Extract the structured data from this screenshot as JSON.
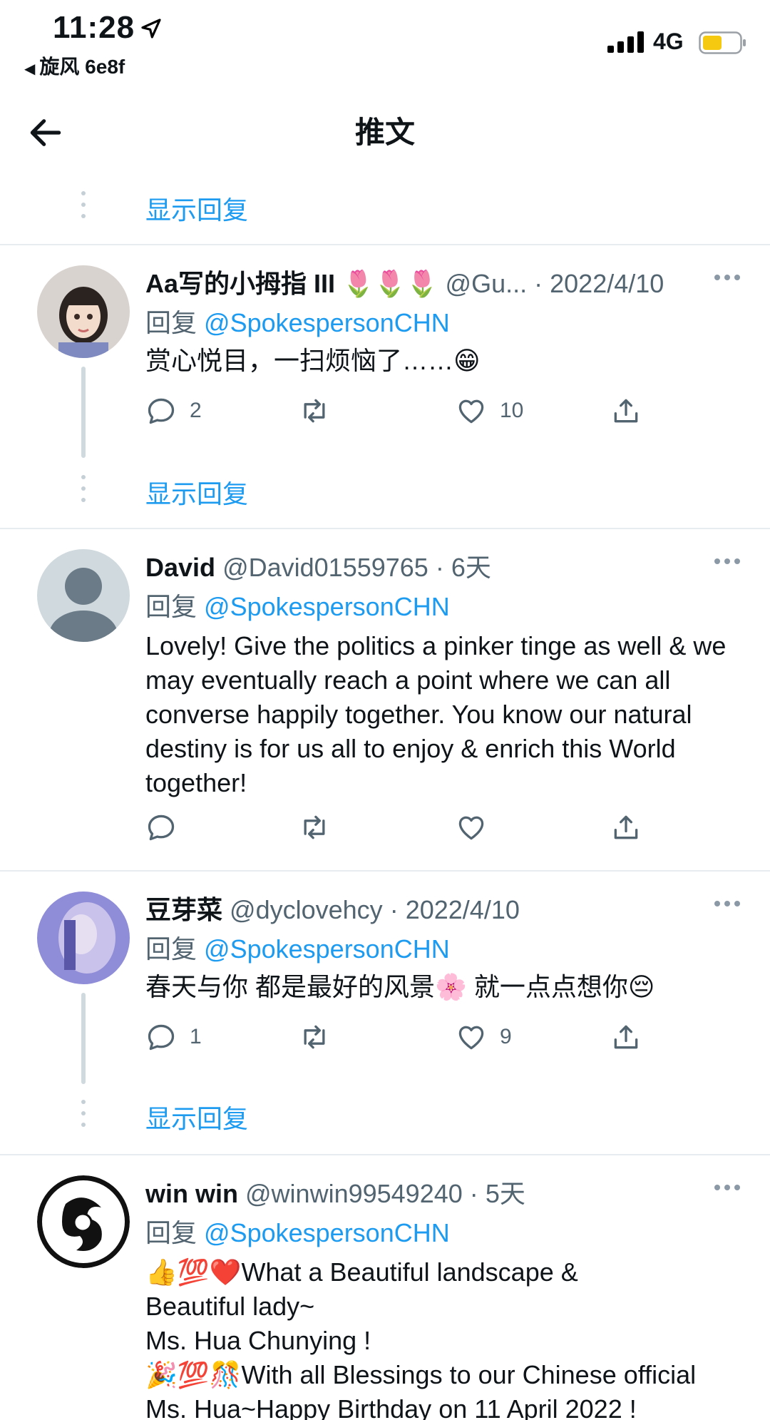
{
  "status": {
    "time": "11:28",
    "back_app": "旋风 6e8f",
    "network": "4G"
  },
  "nav": {
    "title": "推文"
  },
  "show_replies_label": "显示回复",
  "tweets": [
    {
      "name": "Aa写的小拇指 III 🌷🌷🌷",
      "handle": "@Gu...",
      "sep": "·",
      "date": "2022/4/10",
      "reply_prefix": "回复",
      "reply_to": "@SpokespersonCHN",
      "text": "赏心悦目，一扫烦恼了……😁",
      "replies": "2",
      "retweets": "",
      "likes": "10"
    },
    {
      "name": "David",
      "handle": "@David01559765",
      "sep": "·",
      "date": "6天",
      "reply_prefix": "回复",
      "reply_to": "@SpokespersonCHN",
      "text": "Lovely! Give the politics a pinker tinge as well & we may eventually reach a point where we can all converse happily together. You know our natural destiny is for us all to enjoy & enrich this World together!",
      "replies": "",
      "retweets": "",
      "likes": ""
    },
    {
      "name": "豆芽菜",
      "handle": "@dyclovehcy",
      "sep": "·",
      "date": "2022/4/10",
      "reply_prefix": "回复",
      "reply_to": "@SpokespersonCHN",
      "text": "春天与你 都是最好的风景🌸 就一点点想你😔",
      "replies": "1",
      "retweets": "",
      "likes": "9"
    },
    {
      "name": "win win",
      "handle": "@winwin99549240",
      "sep": "·",
      "date": "5天",
      "reply_prefix": "回复",
      "reply_to": "@SpokespersonCHN",
      "text_lines": [
        "👍💯❤️What a Beautiful landscape &",
        "Beautiful  lady~",
        "Ms. Hua Chunying !",
        "🎉💯🎊With all  Blessings to our Chinese official",
        "Ms. Hua~Happy Birthday on 11 April 2022 !"
      ]
    }
  ],
  "colors": {
    "accent": "#1d9bf0",
    "secondary_text": "#536471",
    "divider": "#e6ecf0"
  }
}
